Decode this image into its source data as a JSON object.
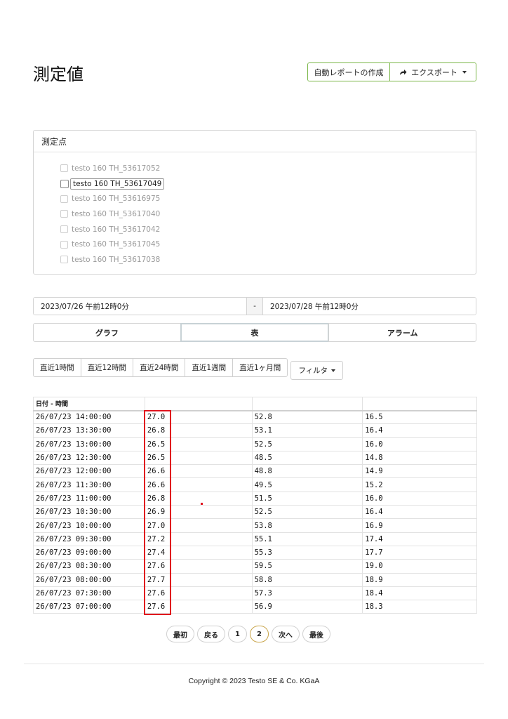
{
  "page": {
    "title": "測定値"
  },
  "actions": {
    "report_label": "自動レポートの作成",
    "export_label": "エクスポート",
    "export_icon": "share-arrow-icon"
  },
  "measurement_panel": {
    "header": "測定点",
    "points": [
      {
        "label": "testo 160 TH_53617052",
        "checked": false,
        "active": false
      },
      {
        "label": "testo 160 TH_53617049",
        "checked": false,
        "active": true
      },
      {
        "label": "testo 160 TH_53616975",
        "checked": false,
        "active": false
      },
      {
        "label": "testo 160 TH_53617040",
        "checked": false,
        "active": false
      },
      {
        "label": "testo 160 TH_53617042",
        "checked": false,
        "active": false
      },
      {
        "label": "testo 160 TH_53617045",
        "checked": false,
        "active": false
      },
      {
        "label": "testo 160 TH_53617038",
        "checked": false,
        "active": false
      }
    ]
  },
  "date_range": {
    "from": "2023/07/26 午前12時0分",
    "separator": "-",
    "to": "2023/07/28 午前12時0分"
  },
  "view_tabs": [
    {
      "label": "グラフ",
      "active": false
    },
    {
      "label": "表",
      "active": true
    },
    {
      "label": "アラーム",
      "active": false
    }
  ],
  "range_buttons": [
    "直近1時間",
    "直近12時間",
    "直近24時間",
    "直近1週間",
    "直近1ヶ月間"
  ],
  "filter": {
    "label": "フィルタ"
  },
  "table": {
    "headers": [
      "日付 - 時間",
      "",
      "",
      ""
    ],
    "rows": [
      [
        "26/07/23 14:00:00",
        "27.0",
        "52.8",
        "16.5"
      ],
      [
        "26/07/23 13:30:00",
        "26.8",
        "53.1",
        "16.4"
      ],
      [
        "26/07/23 13:00:00",
        "26.5",
        "52.5",
        "16.0"
      ],
      [
        "26/07/23 12:30:00",
        "26.5",
        "48.5",
        "14.8"
      ],
      [
        "26/07/23 12:00:00",
        "26.6",
        "48.8",
        "14.9"
      ],
      [
        "26/07/23 11:30:00",
        "26.6",
        "49.5",
        "15.2"
      ],
      [
        "26/07/23 11:00:00",
        "26.8",
        "51.5",
        "16.0"
      ],
      [
        "26/07/23 10:30:00",
        "26.9",
        "52.5",
        "16.4"
      ],
      [
        "26/07/23 10:00:00",
        "27.0",
        "53.8",
        "16.9"
      ],
      [
        "26/07/23 09:30:00",
        "27.2",
        "55.1",
        "17.4"
      ],
      [
        "26/07/23 09:00:00",
        "27.4",
        "55.3",
        "17.7"
      ],
      [
        "26/07/23 08:30:00",
        "27.6",
        "59.5",
        "19.0"
      ],
      [
        "26/07/23 08:00:00",
        "27.7",
        "58.8",
        "18.9"
      ],
      [
        "26/07/23 07:30:00",
        "27.6",
        "57.3",
        "18.4"
      ],
      [
        "26/07/23 07:00:00",
        "27.6",
        "56.9",
        "18.3"
      ]
    ]
  },
  "pagination": {
    "first": "最初",
    "prev": "戻る",
    "pages": [
      "1",
      "2"
    ],
    "current": "2",
    "next": "次へ",
    "last": "最後"
  },
  "footer": {
    "copyright": "Copyright © 2023 Testo SE & Co. KGaA"
  },
  "colors": {
    "accent_green": "#7ab648",
    "highlight_red": "#e0141e",
    "current_page_border": "#c9a54a"
  }
}
